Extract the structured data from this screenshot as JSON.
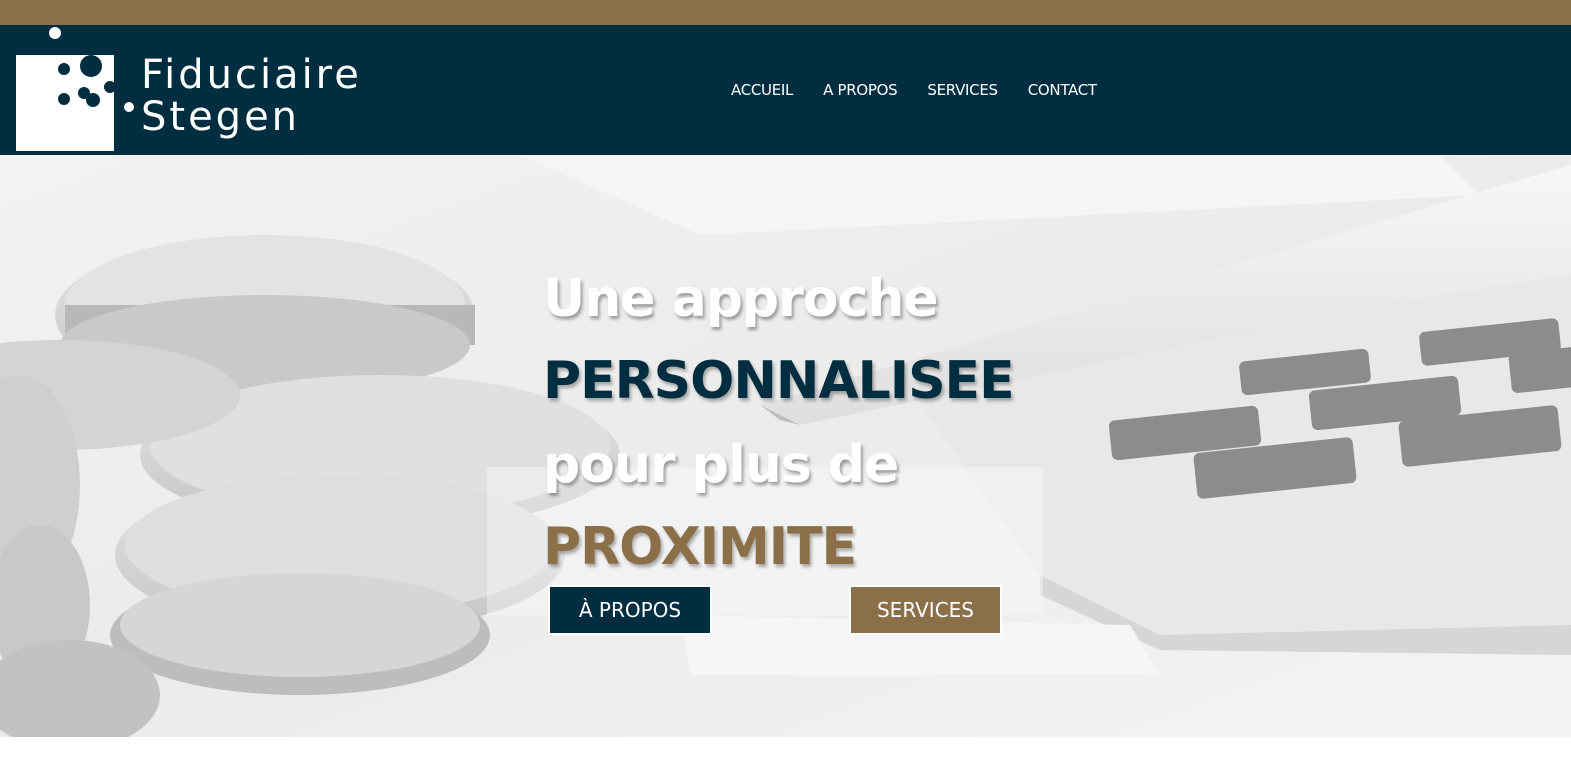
{
  "brand": {
    "name_line1": "Fiduciaire",
    "name_line2": "Stegen",
    "colors": {
      "gold": "#8a6f48",
      "navy": "#002e40",
      "white": "#ffffff"
    }
  },
  "nav": {
    "items": [
      {
        "label": "ACCUEIL"
      },
      {
        "label": "A PROPOS"
      },
      {
        "label": "SERVICES"
      },
      {
        "label": "CONTACT"
      }
    ]
  },
  "hero": {
    "line1": "Une approche",
    "line2": "PERSONNALISEE",
    "line3": "pour plus de",
    "line4": "PROXIMITE",
    "buttons": {
      "about": "À PROPOS",
      "services": "SERVICES"
    },
    "background_image": "coins-pencil-calculator-photo"
  }
}
